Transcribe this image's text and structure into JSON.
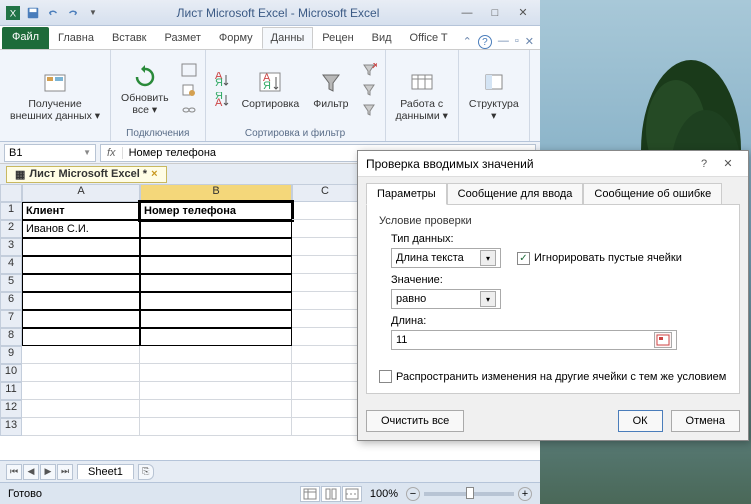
{
  "titlebar": {
    "text": "Лист Microsoft Excel  -  Microsoft Excel"
  },
  "tabs": {
    "file": "Файл",
    "items": [
      "Главна",
      "Вставк",
      "Размет",
      "Форму",
      "Данны",
      "Рецен",
      "Вид",
      "Office T"
    ],
    "active_index": 4
  },
  "ribbon": {
    "group1": {
      "btn1": "Получение\nвнешних данных ▾",
      "label": ""
    },
    "group2": {
      "btn1": "Обновить\nвсе ▾",
      "label": "Подключения"
    },
    "group3": {
      "btn1": "Сортировка",
      "btn2": "Фильтр",
      "label": "Сортировка и фильтр"
    },
    "group4": {
      "btn1": "Работа с\nданными ▾",
      "label": ""
    },
    "group5": {
      "btn1": "Структура\n▾",
      "label": ""
    }
  },
  "formula": {
    "namebox": "B1",
    "fx": "fx",
    "value": "Номер телефона"
  },
  "workbook_tab": "Лист Microsoft Excel *",
  "columns": [
    "A",
    "B",
    "C"
  ],
  "rows": [
    "1",
    "2",
    "3",
    "4",
    "5",
    "6",
    "7",
    "8",
    "9",
    "10",
    "11",
    "12",
    "13"
  ],
  "cells": {
    "A1": "Клиент",
    "B1": "Номер телефона",
    "A2": "Иванов С.И."
  },
  "sheet": {
    "tab": "Sheet1"
  },
  "status": {
    "ready": "Готово",
    "zoom": "100%"
  },
  "dialog": {
    "title": "Проверка вводимых значений",
    "tabs": [
      "Параметры",
      "Сообщение для ввода",
      "Сообщение об ошибке"
    ],
    "section": "Условие проверки",
    "type_label": "Тип данных:",
    "type_value": "Длина текста",
    "ignore_blank": "Игнорировать пустые ячейки",
    "value_label": "Значение:",
    "value_value": "равно",
    "length_label": "Длина:",
    "length_value": "11",
    "apply_other": "Распространить изменения на другие ячейки с тем же условием",
    "clear": "Очистить все",
    "ok": "ОК",
    "cancel": "Отмена",
    "help": "?"
  }
}
